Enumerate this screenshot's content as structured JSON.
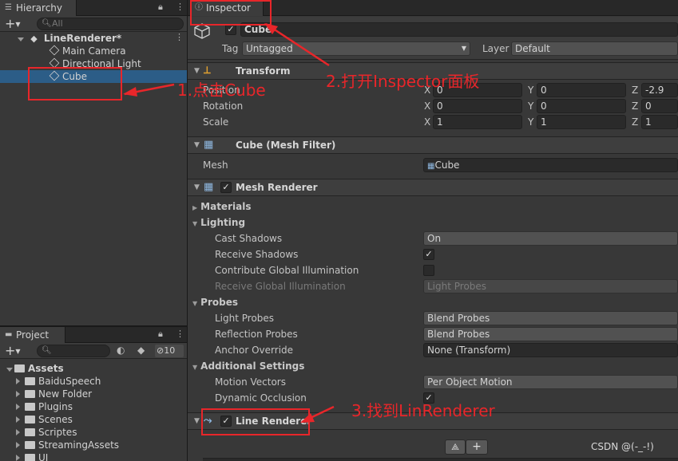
{
  "hierarchy": {
    "tab": "Hierarchy",
    "search_placeholder": "All",
    "scene": "LineRenderer*",
    "items": [
      "Main Camera",
      "Directional Light",
      "Cube"
    ]
  },
  "project": {
    "tab": "Project",
    "hidden_count": "10",
    "root": "Assets",
    "folders": [
      "BaiduSpeech",
      "New Folder",
      "Plugins",
      "Scenes",
      "Scriptes",
      "StreamingAssets",
      "UI"
    ]
  },
  "inspector": {
    "tab": "Inspector",
    "object_name": "Cube",
    "tag_label": "Tag",
    "tag_value": "Untagged",
    "layer_label": "Layer",
    "layer_value": "Default",
    "transform": {
      "title": "Transform",
      "position_label": "Position",
      "rotation_label": "Rotation",
      "scale_label": "Scale",
      "position": {
        "x": "0",
        "y": "0",
        "z": "-2.9"
      },
      "rotation": {
        "x": "0",
        "y": "0",
        "z": "0"
      },
      "scale": {
        "x": "1",
        "y": "1",
        "z": "1"
      },
      "axis_x": "X",
      "axis_y": "Y",
      "axis_z": "Z"
    },
    "mesh_filter": {
      "title": "Cube (Mesh Filter)",
      "mesh_label": "Mesh",
      "mesh_value": "Cube"
    },
    "mesh_renderer": {
      "title": "Mesh Renderer",
      "materials": "Materials",
      "lighting": "Lighting",
      "cast_shadows_label": "Cast Shadows",
      "cast_shadows_value": "On",
      "receive_shadows_label": "Receive Shadows",
      "contribute_gi_label": "Contribute Global Illumination",
      "receive_gi_label": "Receive Global Illumination",
      "receive_gi_value": "Light Probes",
      "probes": "Probes",
      "light_probes_label": "Light Probes",
      "light_probes_value": "Blend Probes",
      "reflection_probes_label": "Reflection Probes",
      "reflection_probes_value": "Blend Probes",
      "anchor_override_label": "Anchor Override",
      "anchor_override_value": "None (Transform)",
      "additional_settings": "Additional Settings",
      "motion_vectors_label": "Motion Vectors",
      "motion_vectors_value": "Per Object Motion",
      "dynamic_occlusion_label": "Dynamic Occlusion"
    },
    "line_renderer": {
      "title": "Line Renderer"
    }
  },
  "annotations": {
    "step1": "1.点击Cube",
    "step2": "2.打开Inspector面板",
    "step3": "3.找到LinRenderer"
  },
  "watermark": "CSDN @(-_-!)",
  "colors": {
    "annotation_red": "#e8262a",
    "selection_blue": "#2c5d87",
    "panel_bg": "#383838"
  }
}
